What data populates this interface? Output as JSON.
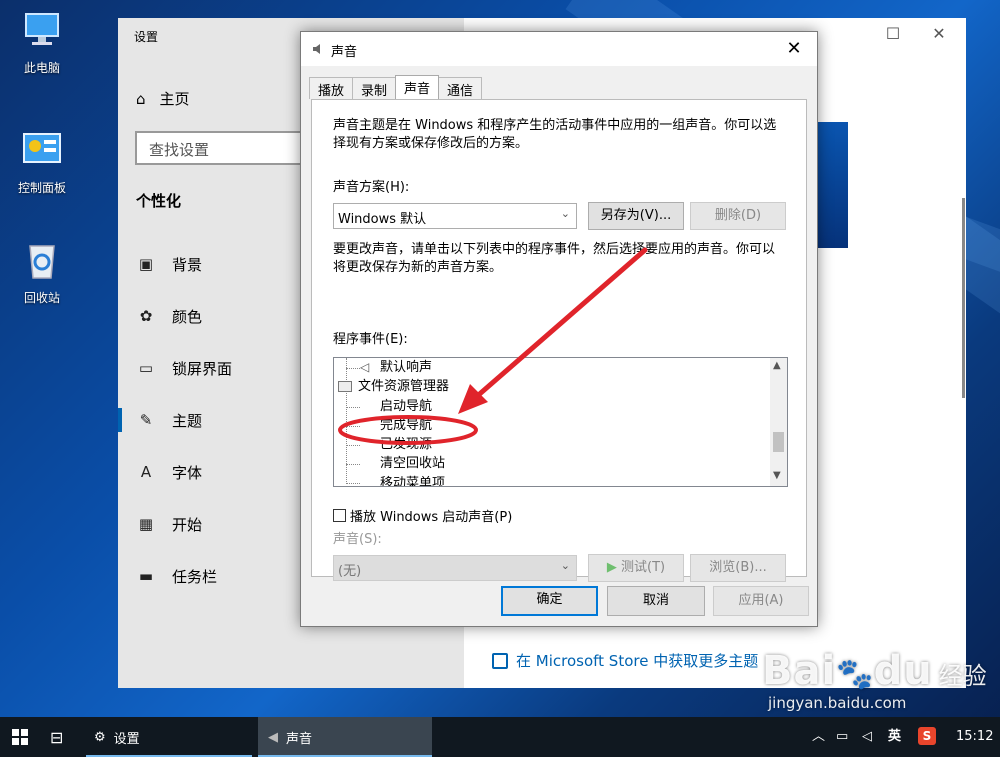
{
  "desktop": {
    "icons": [
      {
        "label": "此电脑"
      },
      {
        "label": "控制面板"
      },
      {
        "label": "回收站"
      }
    ]
  },
  "settings": {
    "title": "设置",
    "home": "主页",
    "search_placeholder": "查找设置",
    "section": "个性化",
    "nav": [
      {
        "label": "背景",
        "icon": "image-icon"
      },
      {
        "label": "颜色",
        "icon": "palette-icon"
      },
      {
        "label": "锁屏界面",
        "icon": "lock-screen-icon"
      },
      {
        "label": "主题",
        "icon": "theme-icon"
      },
      {
        "label": "字体",
        "icon": "font-icon"
      },
      {
        "label": "开始",
        "icon": "start-icon"
      },
      {
        "label": "任务栏",
        "icon": "taskbar-icon"
      }
    ],
    "active_nav": "主题",
    "store_link": "在 Microsoft Store 中获取更多主题"
  },
  "dialog": {
    "title": "声音",
    "tabs": [
      "播放",
      "录制",
      "声音",
      "通信"
    ],
    "selected_tab": "声音",
    "intro": [
      "声音主题是在 Windows 和程序产生的活动事件中应用的一组声音。你可以选",
      "择现有方案或保存修改后的方案。"
    ],
    "scheme_label": "声音方案(H):",
    "scheme_value": "Windows 默认",
    "save_as": "另存为(V)...",
    "delete": "删除(D)",
    "change_text": [
      "要更改声音，请单击以下列表中的程序事件，然后选择要应用的声音。你可以",
      "将更改保存为新的声音方案。"
    ],
    "events_label": "程序事件(E):",
    "events": [
      {
        "label": "默认响声",
        "level": 1
      },
      {
        "label": "文件资源管理器",
        "level": 0
      },
      {
        "label": "启动导航",
        "level": 1
      },
      {
        "label": "完成导航",
        "level": 1
      },
      {
        "label": "已发现源",
        "level": 1
      },
      {
        "label": "清空回收站",
        "level": 1
      },
      {
        "label": "移动菜单项",
        "level": 1
      }
    ],
    "play_startup": "播放 Windows 启动声音(P)",
    "sound_label": "声音(S):",
    "sound_value": "(无)",
    "test": "测试(T)",
    "browse": "浏览(B)...",
    "ok": "确定",
    "cancel": "取消",
    "apply": "应用(A)"
  },
  "taskbar": {
    "settings": "设置",
    "sound": "声音",
    "ime": "英",
    "time": "15:12"
  },
  "watermark": {
    "brand": "Bai",
    "brand2": "du",
    "brand_cn": "经验",
    "url": "jingyan.baidu.com"
  },
  "colors": {
    "accent": "#0063b1",
    "annotation": "#e0242b"
  }
}
